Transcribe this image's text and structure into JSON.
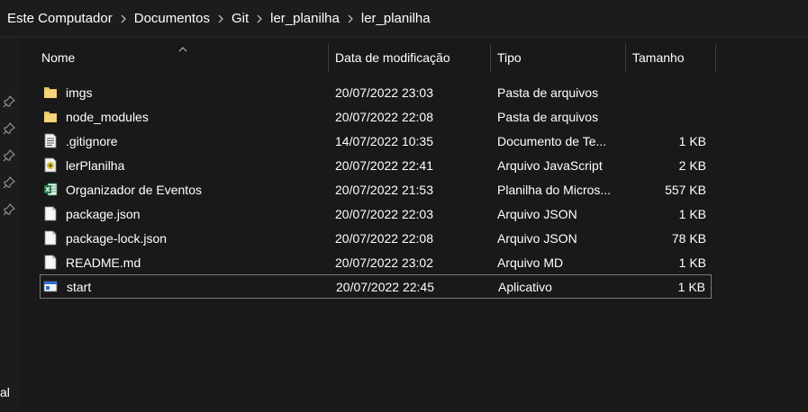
{
  "breadcrumb": [
    "Este Computador",
    "Documentos",
    "Git",
    "ler_planilha",
    "ler_planilha"
  ],
  "left_pane": {
    "partial_label": "al"
  },
  "columns": {
    "name": "Nome",
    "date": "Data de modificação",
    "type": "Tipo",
    "size": "Tamanho"
  },
  "files": [
    {
      "icon": "folder-icon",
      "name": "imgs",
      "date": "20/07/2022 23:03",
      "type": "Pasta de arquivos",
      "size": ""
    },
    {
      "icon": "folder-icon",
      "name": "node_modules",
      "date": "20/07/2022 22:08",
      "type": "Pasta de arquivos",
      "size": ""
    },
    {
      "icon": "text-file-icon",
      "name": ".gitignore",
      "date": "14/07/2022 10:35",
      "type": "Documento de Te...",
      "size": "1 KB"
    },
    {
      "icon": "javascript-file-icon",
      "name": "lerPlanilha",
      "date": "20/07/2022 22:41",
      "type": "Arquivo JavaScript",
      "size": "2 KB"
    },
    {
      "icon": "excel-file-icon",
      "name": "Organizador de Eventos",
      "date": "20/07/2022 21:53",
      "type": "Planilha do Micros...",
      "size": "557 KB"
    },
    {
      "icon": "file-icon",
      "name": "package.json",
      "date": "20/07/2022 22:03",
      "type": "Arquivo JSON",
      "size": "1 KB"
    },
    {
      "icon": "file-icon",
      "name": "package-lock.json",
      "date": "20/07/2022 22:08",
      "type": "Arquivo JSON",
      "size": "78 KB"
    },
    {
      "icon": "file-icon",
      "name": "README.md",
      "date": "20/07/2022 23:02",
      "type": "Arquivo MD",
      "size": "1 KB"
    },
    {
      "icon": "application-icon",
      "name": "start",
      "date": "20/07/2022 22:45",
      "type": "Aplicativo",
      "size": "1 KB"
    }
  ],
  "colors": {
    "background": "#191919",
    "folder": "#e8c35a",
    "excel": "#1f7a45",
    "selection_border": "#7a7a7a"
  }
}
